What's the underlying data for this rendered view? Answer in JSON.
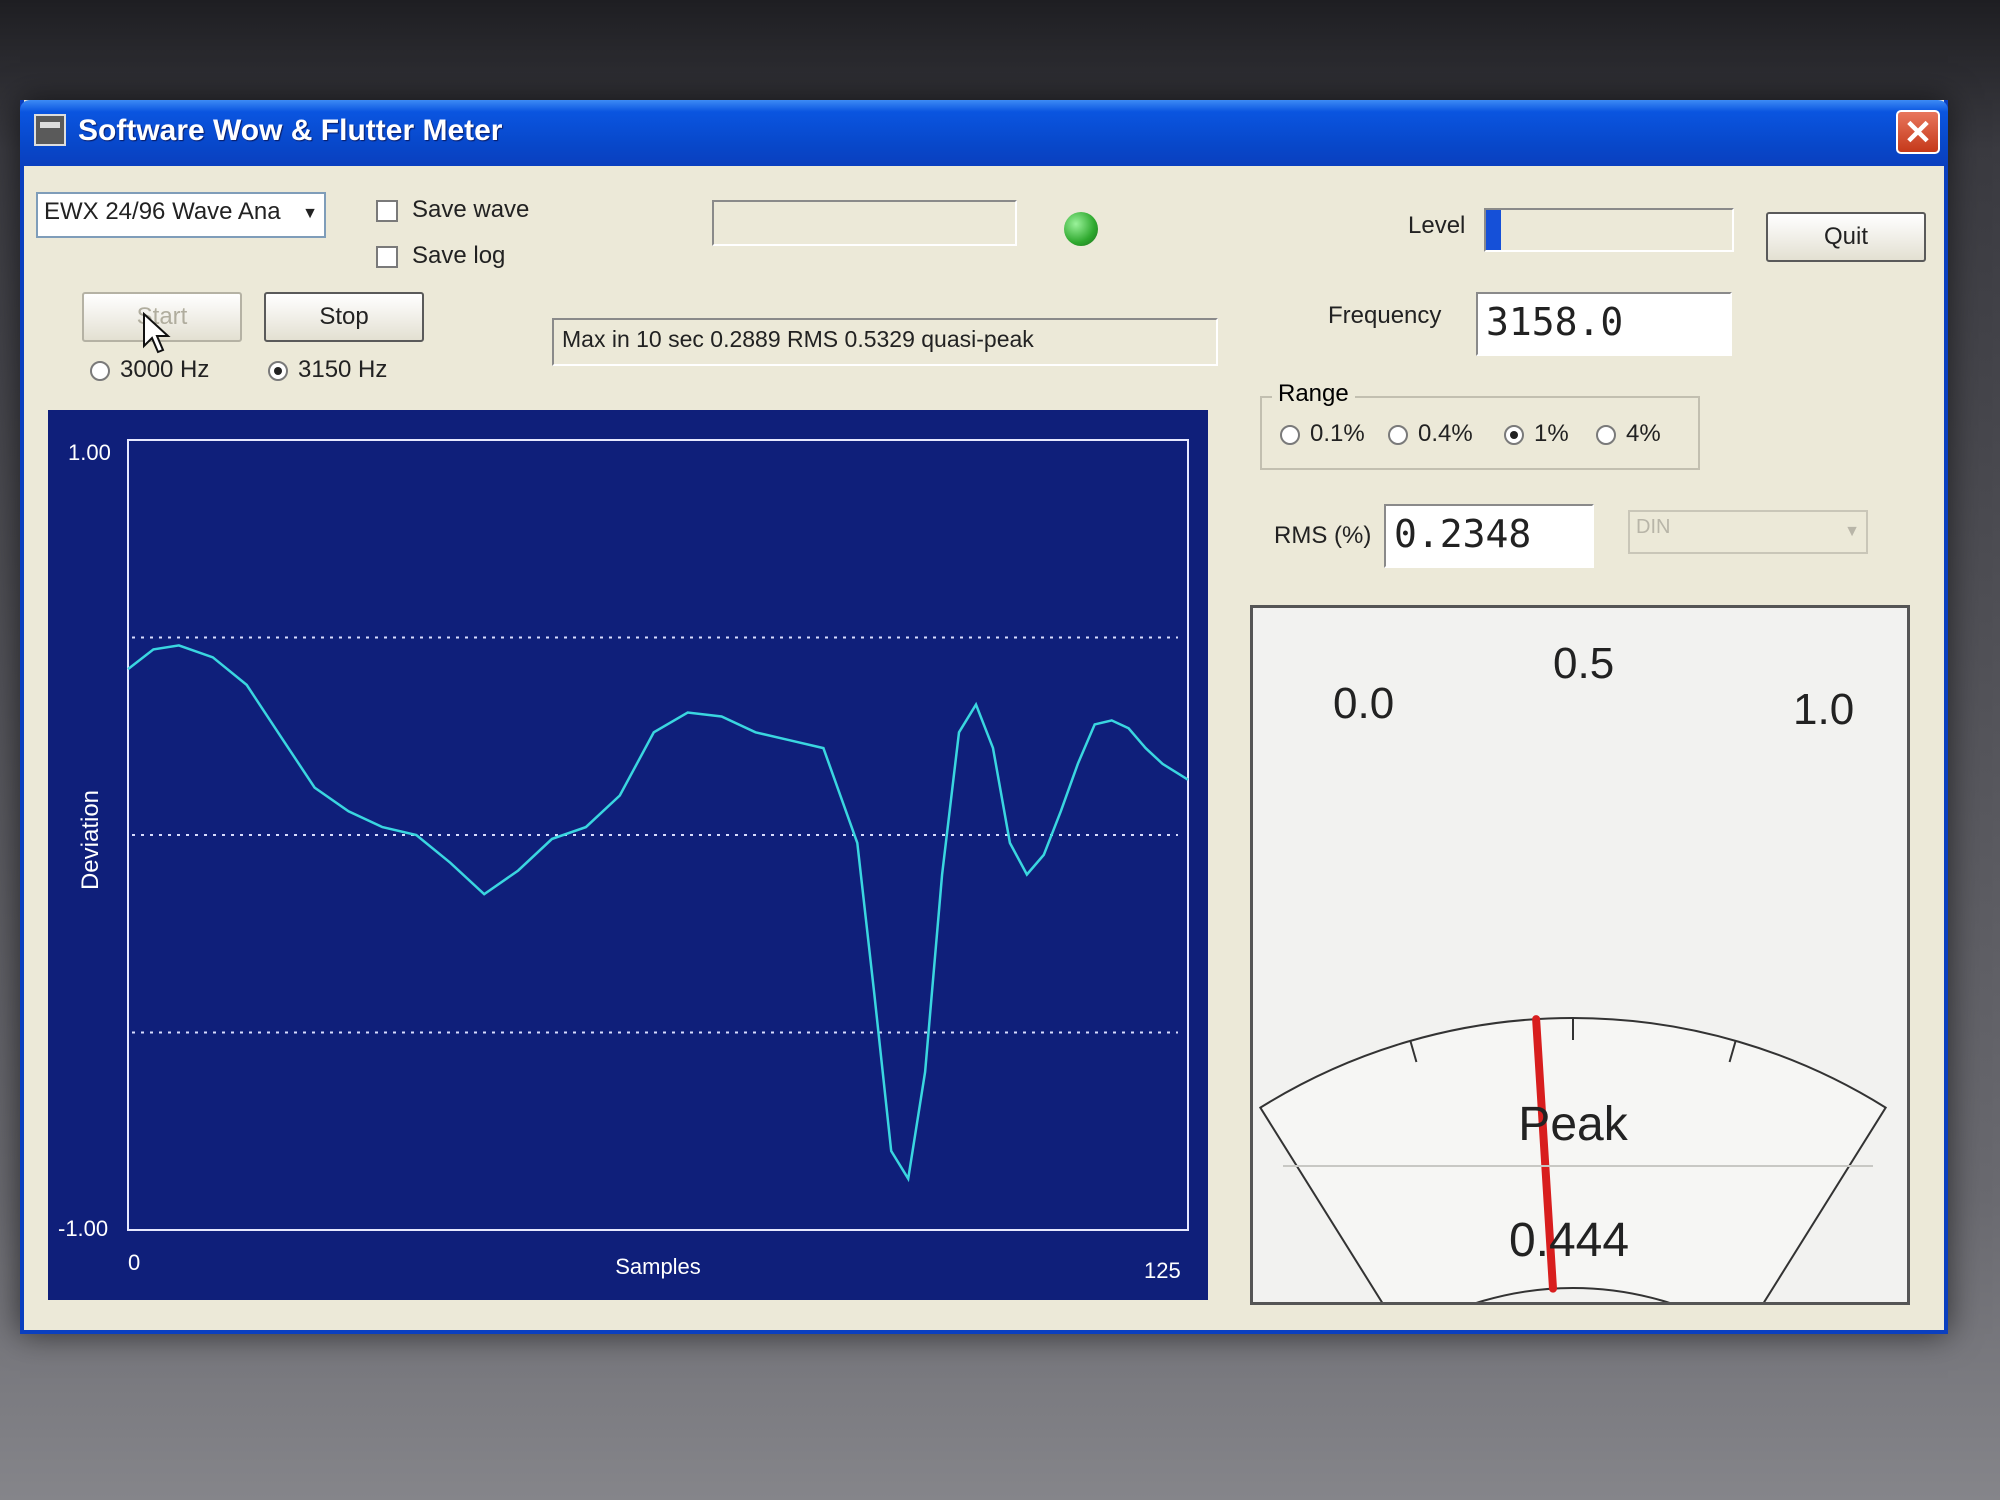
{
  "window": {
    "title": "Software Wow & Flutter Meter",
    "close_label": "✕"
  },
  "device_select": {
    "value": "EWX 24/96 Wave Ana"
  },
  "options": {
    "save_wave": "Save wave",
    "save_log": "Save log"
  },
  "buttons": {
    "start": "Start",
    "stop": "Stop",
    "quit": "Quit"
  },
  "reference": {
    "option_3000": "3000 Hz",
    "option_3150": "3150 Hz",
    "selected": "3150 Hz"
  },
  "status": {
    "max_text": "Max in 10 sec 0.2889 RMS 0.5329 quasi-peak",
    "indicator_color": "#2ea82e"
  },
  "level": {
    "label": "Level",
    "value": 0.06,
    "bar_color": "#1550d8"
  },
  "frequency": {
    "label": "Frequency",
    "value": "3158.0"
  },
  "range": {
    "label": "Range",
    "options": [
      "0.1%",
      "0.4%",
      "1%",
      "4%"
    ],
    "selected": "1%"
  },
  "rms": {
    "label": "RMS (%)",
    "value": "0.2348",
    "weighting": "DIN"
  },
  "meter": {
    "scale_labels": [
      "0.0",
      "0.5",
      "1.0"
    ],
    "title": "Peak",
    "value": "0.444",
    "needle_value": 0.444,
    "needle_color": "#d81e1e"
  },
  "chart_data": {
    "type": "line",
    "xlabel": "Samples",
    "ylabel": "Deviation",
    "xlim": [
      0,
      125
    ],
    "ylim": [
      -1.0,
      1.0
    ],
    "x_tick_labels": [
      "0",
      "125"
    ],
    "y_tick_labels": [
      "1.00",
      "-1.00"
    ],
    "grid_y": [
      0.5,
      0.0,
      -0.5
    ],
    "line_color": "#3ad6e0",
    "background": "#0f1f7a",
    "series": [
      {
        "x": [
          0,
          3,
          6,
          10,
          14,
          18,
          22,
          26,
          30,
          34,
          38,
          42,
          46,
          50,
          54,
          58,
          62,
          66,
          70,
          74,
          78,
          82,
          86,
          88,
          90,
          92,
          94,
          96,
          98,
          100,
          102,
          104,
          106,
          108,
          110,
          112,
          114,
          116,
          118,
          120,
          122,
          125
        ],
        "y": [
          0.42,
          0.47,
          0.48,
          0.45,
          0.38,
          0.25,
          0.12,
          0.06,
          0.02,
          0.0,
          -0.07,
          -0.15,
          -0.09,
          -0.01,
          0.02,
          0.1,
          0.26,
          0.31,
          0.3,
          0.26,
          0.24,
          0.22,
          -0.02,
          -0.4,
          -0.8,
          -0.87,
          -0.6,
          -0.1,
          0.26,
          0.33,
          0.22,
          -0.02,
          -0.1,
          -0.05,
          0.06,
          0.18,
          0.28,
          0.29,
          0.27,
          0.22,
          0.18,
          0.14
        ]
      }
    ]
  }
}
